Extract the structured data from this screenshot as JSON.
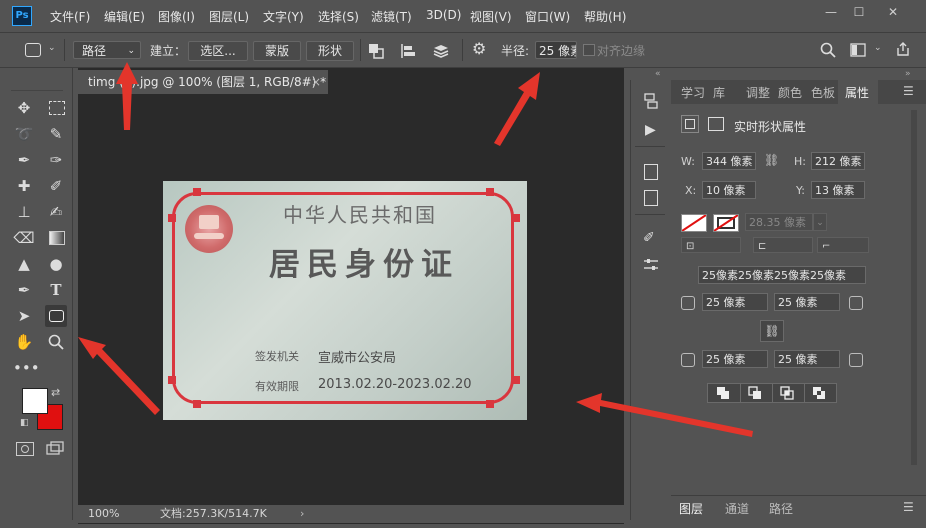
{
  "app": {
    "logo": "Ps"
  },
  "menu": [
    "文件(F)",
    "编辑(E)",
    "图像(I)",
    "图层(L)",
    "文字(Y)",
    "选择(S)",
    "滤镜(T)",
    "3D(D)",
    "视图(V)",
    "窗口(W)",
    "帮助(H)"
  ],
  "window_controls": {
    "minimize": "—",
    "restore": "☐",
    "close": "✕"
  },
  "options": {
    "mode_select": "路径",
    "build_label": "建立：",
    "selection_btn": "选区...",
    "mask_btn": "蒙版",
    "shape_btn": "形状",
    "radius_label": "半径:",
    "radius_value": "25 像素",
    "align_edges": "对齐边缘"
  },
  "document": {
    "tab_title": "timg (1).jpg @ 100% (图层 1, RGB/8#) *",
    "tab_close": "×",
    "zoom": "100%",
    "doc_info": "文档:257.3K/514.7K",
    "status_arrow": "›"
  },
  "id_card": {
    "title": "中华人民共和国",
    "subtitle": "居民身份证",
    "issuer_label": "签发机关",
    "issuer_value": "宣威市公安局",
    "validity_label": "有效期限",
    "validity_value": "2013.02.20-2023.02.20"
  },
  "panel_tabs": [
    "学习",
    "库",
    "调整",
    "颜色",
    "色板",
    "属性"
  ],
  "properties": {
    "heading": "实时形状属性",
    "w_label": "W:",
    "w_value": "344 像素",
    "h_label": "H:",
    "h_value": "212 像素",
    "x_label": "X:",
    "x_value": "10 像素",
    "y_label": "Y:",
    "y_value": "13 像素",
    "stroke_width": "28.35 像素",
    "corner_summary": "25像素25像素25像素25像素",
    "corner_tl": "25 像素",
    "corner_tr": "25 像素",
    "corner_bl": "25 像素",
    "corner_br": "25 像素"
  },
  "bottom_tabs": [
    "图层",
    "通道",
    "路径"
  ],
  "colors": {
    "accent": "#31a8ff",
    "arrow": "#e3352b",
    "fg": "#ffffff",
    "bg": "#e01010",
    "path": "#d9363e"
  }
}
